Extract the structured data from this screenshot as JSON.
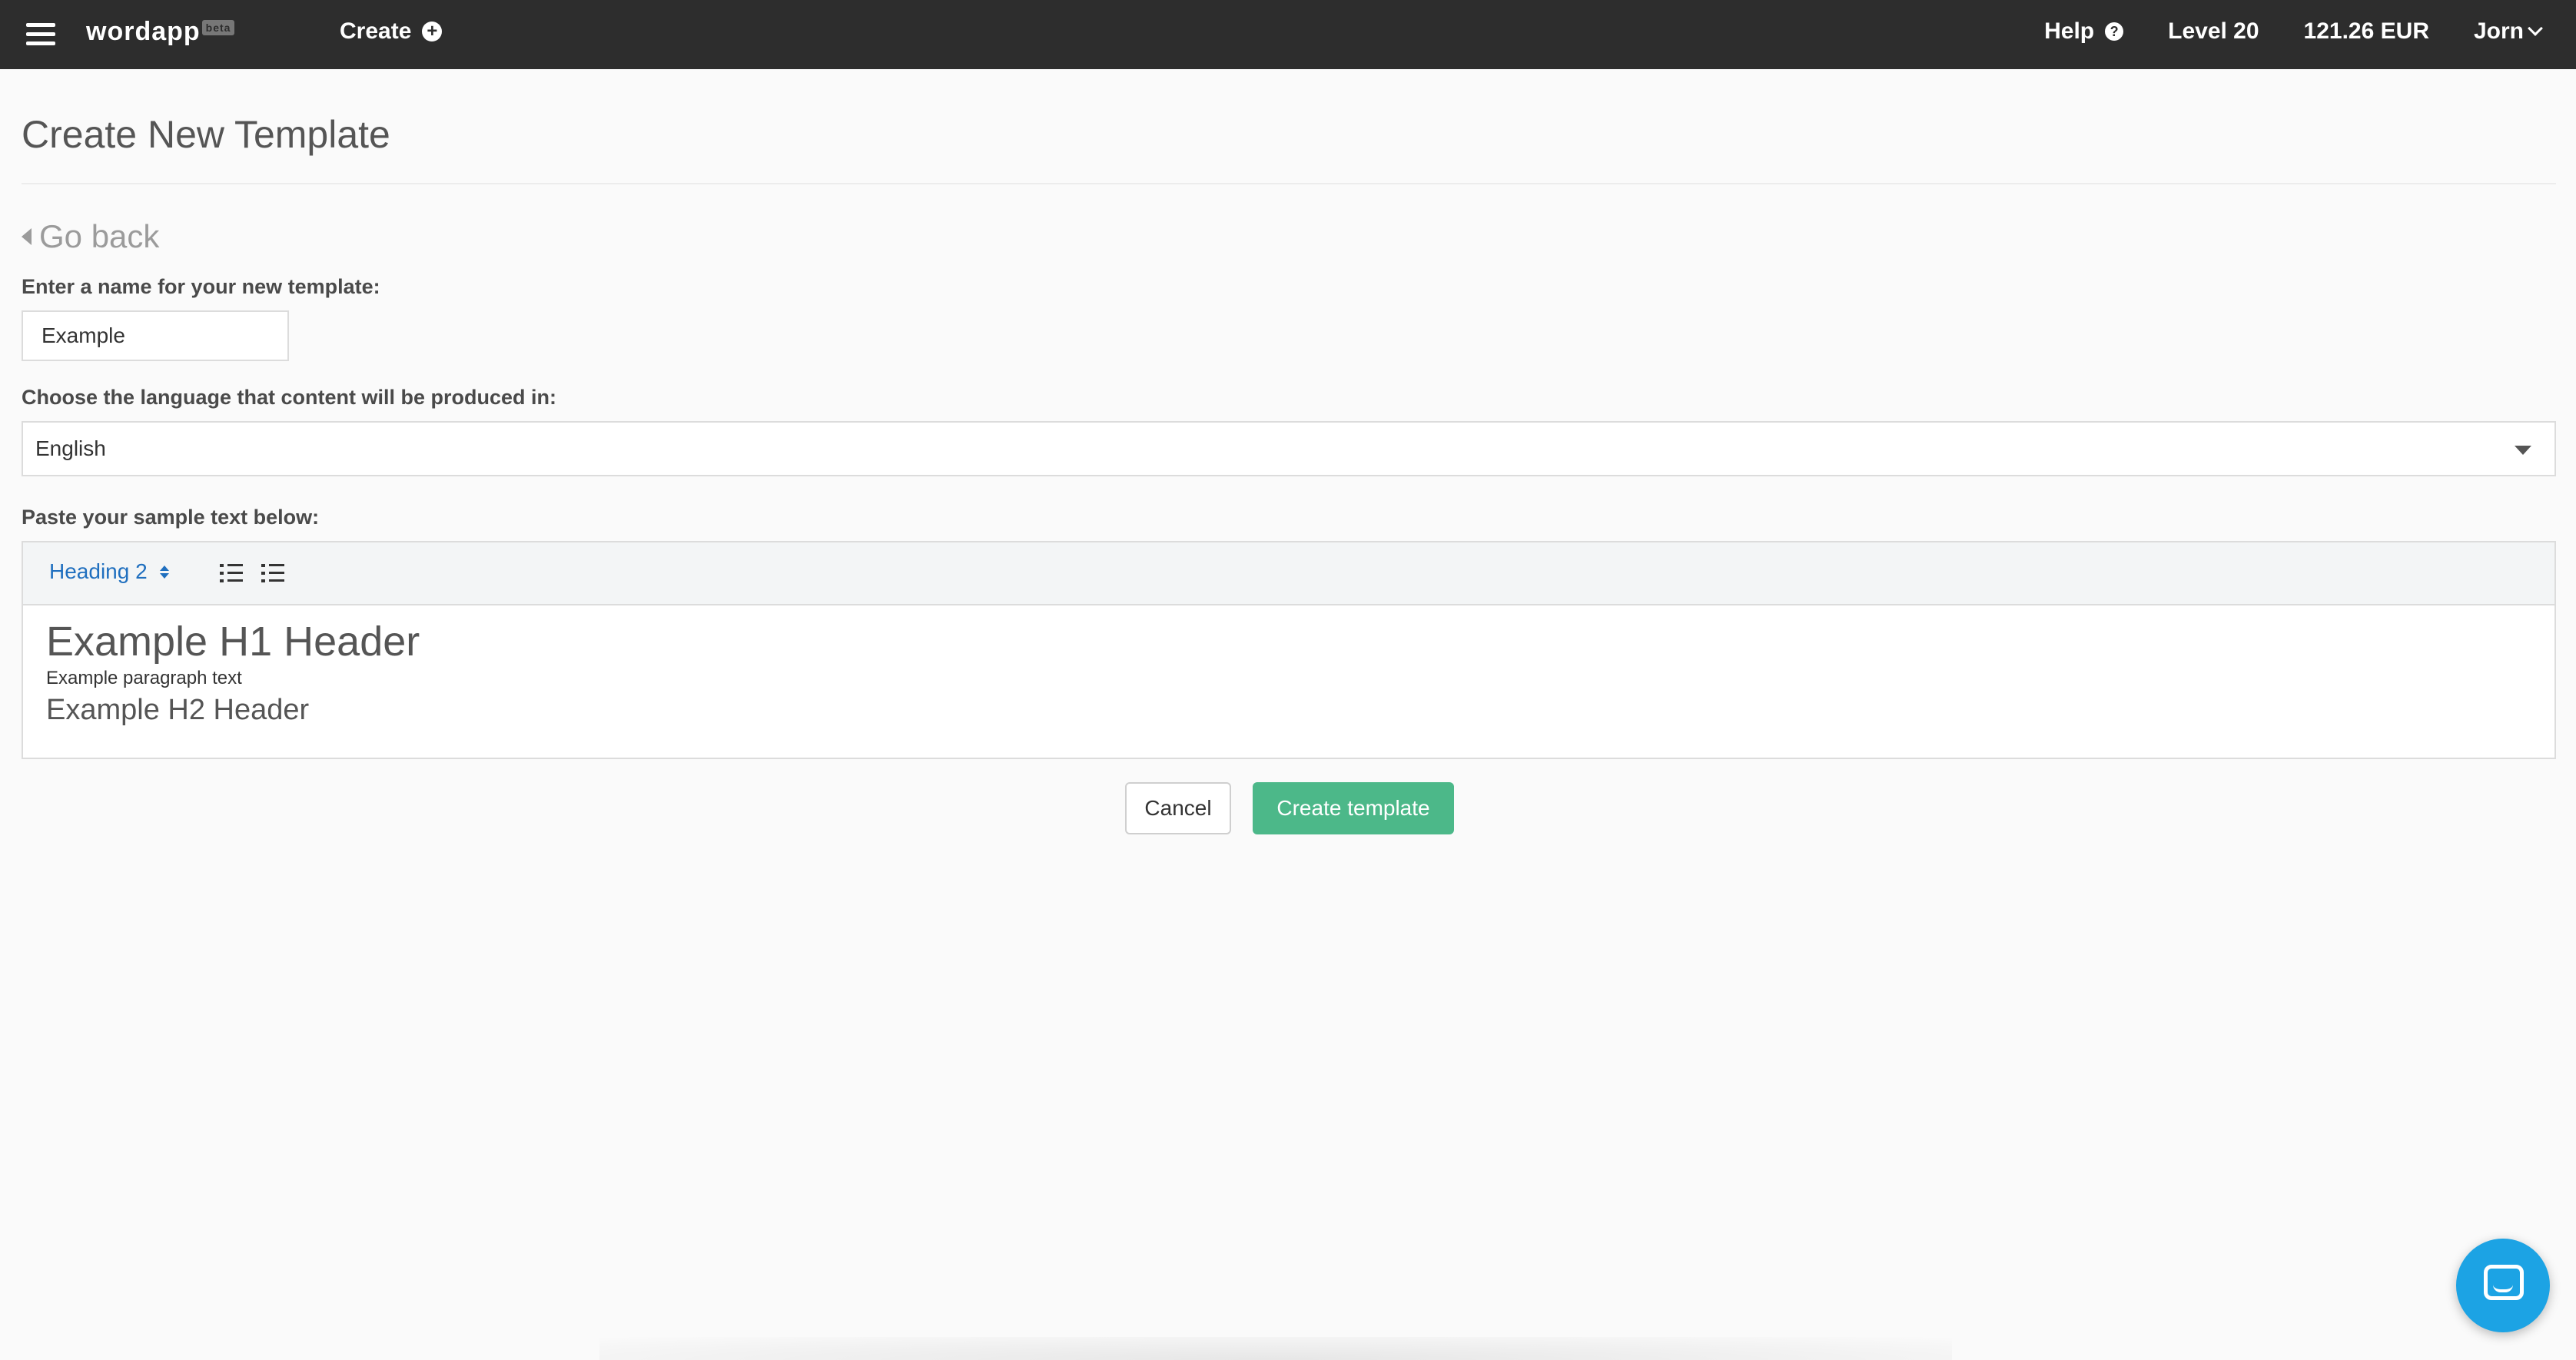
{
  "nav": {
    "brand": "wordapp",
    "brand_badge": "beta",
    "create_label": "Create",
    "help_label": "Help",
    "level_label": "Level 20",
    "balance_label": "121.26 EUR",
    "user_label": "Jorn"
  },
  "page": {
    "title": "Create New Template",
    "go_back_label": "Go back"
  },
  "form": {
    "name_label": "Enter a name for your new template:",
    "name_value": "Example",
    "language_label": "Choose the language that content will be produced in:",
    "language_value": "English",
    "sample_label": "Paste your sample text below:"
  },
  "editor": {
    "format_select_value": "Heading 2",
    "content": {
      "h1": "Example H1 Header",
      "paragraph": "Example paragraph text",
      "h2": "Example H2 Header"
    }
  },
  "actions": {
    "cancel_label": "Cancel",
    "create_label": "Create template"
  },
  "colors": {
    "topbar": "#2d2d2d",
    "primary_button": "#4cb889",
    "link_blue": "#1f6fbf",
    "chat_blue": "#1ca3e4"
  },
  "icons": [
    "hamburger-menu-icon",
    "plus-circle-icon",
    "help-circle-icon",
    "chevron-down-icon",
    "caret-left-icon",
    "caret-down-icon",
    "up-down-arrows-icon",
    "ordered-list-icon",
    "unordered-list-icon",
    "chat-icon"
  ]
}
